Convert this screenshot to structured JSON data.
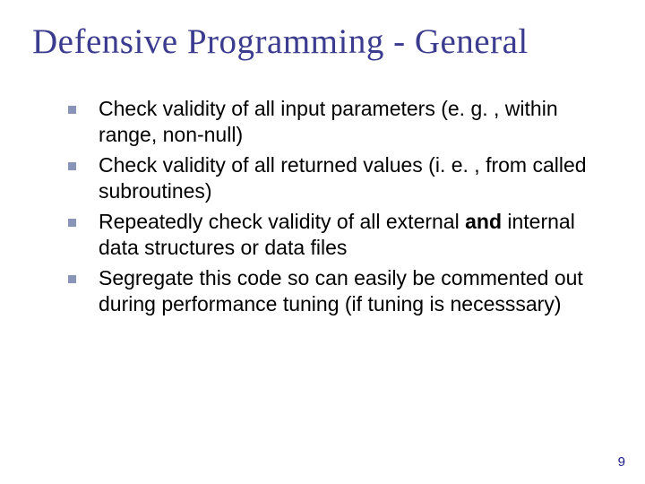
{
  "title": "Defensive Programming - General",
  "bullets": [
    {
      "pre": "Check validity of all input parameters (e. g. , within range, non-null)",
      "bold": "",
      "post": ""
    },
    {
      "pre": "Check validity of all returned values (i. e. , from called subroutines)",
      "bold": "",
      "post": ""
    },
    {
      "pre": "Repeatedly check validity of all external ",
      "bold": "and",
      "post": " internal data structures or data files"
    },
    {
      "pre": "Segregate this code so can easily be commented out during performance tuning (if tuning is necesssary)",
      "bold": "",
      "post": ""
    }
  ],
  "page_number": "9"
}
